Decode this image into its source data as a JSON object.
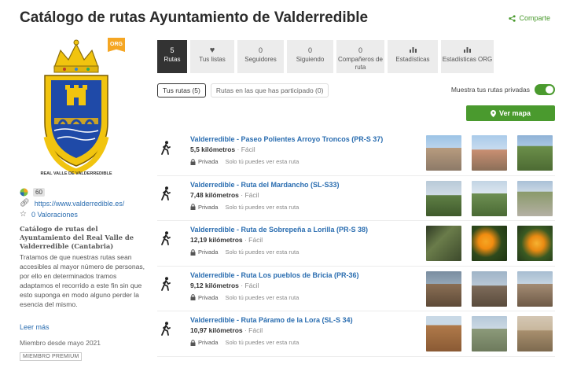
{
  "header": {
    "title": "Catálogo de rutas Ayuntamiento de Valderredible",
    "share_label": "Comparte"
  },
  "profile": {
    "org_badge": "ORG",
    "logo_text": "REAL VALLE DE VALDERREDIBLE",
    "level": "60",
    "website": "https://www.valderredible.es/",
    "ratings": "0 Valoraciones",
    "desc_title": "Catálogo de rutas del Ayuntamiento del Real Valle de Valderredible (Cantabria)",
    "desc_body": "Tratamos de que nuestras rutas sean accesibles al mayor número de personas, por ello en determinados tramos adaptamos el recorrido a este fin sin que esto suponga en modo alguno perder la esencia del mismo.",
    "read_more": "Leer más",
    "member_since": "Miembro desde mayo 2021",
    "premium": "MIEMBRO PREMIUM"
  },
  "tiles": [
    {
      "num": "5",
      "label": "Rutas",
      "active": true
    },
    {
      "num": "",
      "label": "Tus listas",
      "icon": "heart-icon"
    },
    {
      "num": "0",
      "label": "Seguidores"
    },
    {
      "num": "0",
      "label": "Siguiendo"
    },
    {
      "num": "0",
      "label": "Compañeros de ruta"
    },
    {
      "num": "",
      "label": "Estadísticas",
      "icon": "bar-chart-icon"
    },
    {
      "num": "",
      "label": "Estadísticas ORG",
      "icon": "bar-chart-icon"
    }
  ],
  "tabs": {
    "mine": "Tus rutas (5)",
    "participated": "Rutas en las que has participado (0)"
  },
  "toggle_label": "Muestra tus rutas privadas",
  "map_button": "Ver mapa",
  "routes": [
    {
      "title": "Valderredible - Paseo Polientes Arroyo Troncos (PR-S 37)",
      "km": "5,5 kilómetros",
      "difficulty": "Fácil",
      "privacy": "Privada",
      "privacy_note": "Solo tú puedes ver esta ruta"
    },
    {
      "title": "Valderredible - Ruta del Mardancho (SL-S33)",
      "km": "7,48 kilómetros",
      "difficulty": "Fácil",
      "privacy": "Privada",
      "privacy_note": "Solo tú puedes ver esta ruta"
    },
    {
      "title": "Valderredible - Ruta de Sobrepeña a Lorilla (PR-S 38)",
      "km": "12,19 kilómetros",
      "difficulty": "Fácil",
      "privacy": "Privada",
      "privacy_note": "Solo tú puedes ver esta ruta"
    },
    {
      "title": "Valderredible - Ruta Los pueblos de Bricia (PR-36)",
      "km": "9,12 kilómetros",
      "difficulty": "Fácil",
      "privacy": "Privada",
      "privacy_note": "Solo tú puedes ver esta ruta"
    },
    {
      "title": "Valderredible - Ruta Páramo de la Lora (SL-S 34)",
      "km": "10,97 kilómetros",
      "difficulty": "Fácil",
      "privacy": "Privada",
      "privacy_note": "Solo tú puedes ver esta ruta"
    }
  ],
  "colors": {
    "accent_green": "#4a9a2e",
    "link_blue": "#2a6db0",
    "org_orange": "#f5a623"
  }
}
